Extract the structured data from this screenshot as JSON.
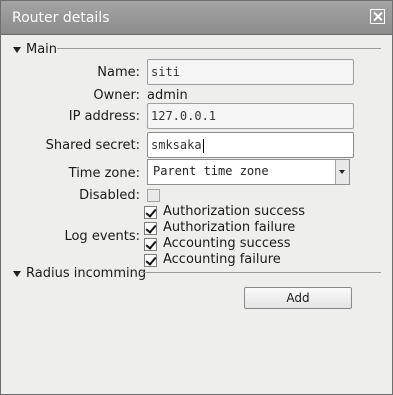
{
  "window": {
    "title": "Router details"
  },
  "sections": {
    "main": "Main",
    "radius": "Radius incomming"
  },
  "form": {
    "name": {
      "label": "Name:",
      "value": "siti"
    },
    "owner": {
      "label": "Owner:",
      "value": "admin"
    },
    "ip_address": {
      "label": "IP address:",
      "value": "127.0.0.1"
    },
    "shared_secret": {
      "label": "Shared secret:",
      "value": "smksaka"
    },
    "time_zone": {
      "label": "Time zone:",
      "value": "Parent time zone"
    },
    "disabled": {
      "label": "Disabled:",
      "checked": false
    },
    "log_events": {
      "label": "Log events:",
      "options": [
        {
          "label": "Authorization success",
          "checked": true
        },
        {
          "label": "Authorization failure",
          "checked": true
        },
        {
          "label": "Accounting success",
          "checked": true
        },
        {
          "label": "Accounting failure",
          "checked": true
        }
      ]
    }
  },
  "actions": {
    "add": "Add"
  },
  "icons": {
    "close": "close-icon",
    "section_toggle": "triangle-down-icon",
    "dropdown": "chevron-down-icon",
    "check": "checkmark-icon"
  },
  "colors": {
    "titlebar": "#999999",
    "dialog_bg": "#eeeeec",
    "title_text": "#ffffff"
  }
}
